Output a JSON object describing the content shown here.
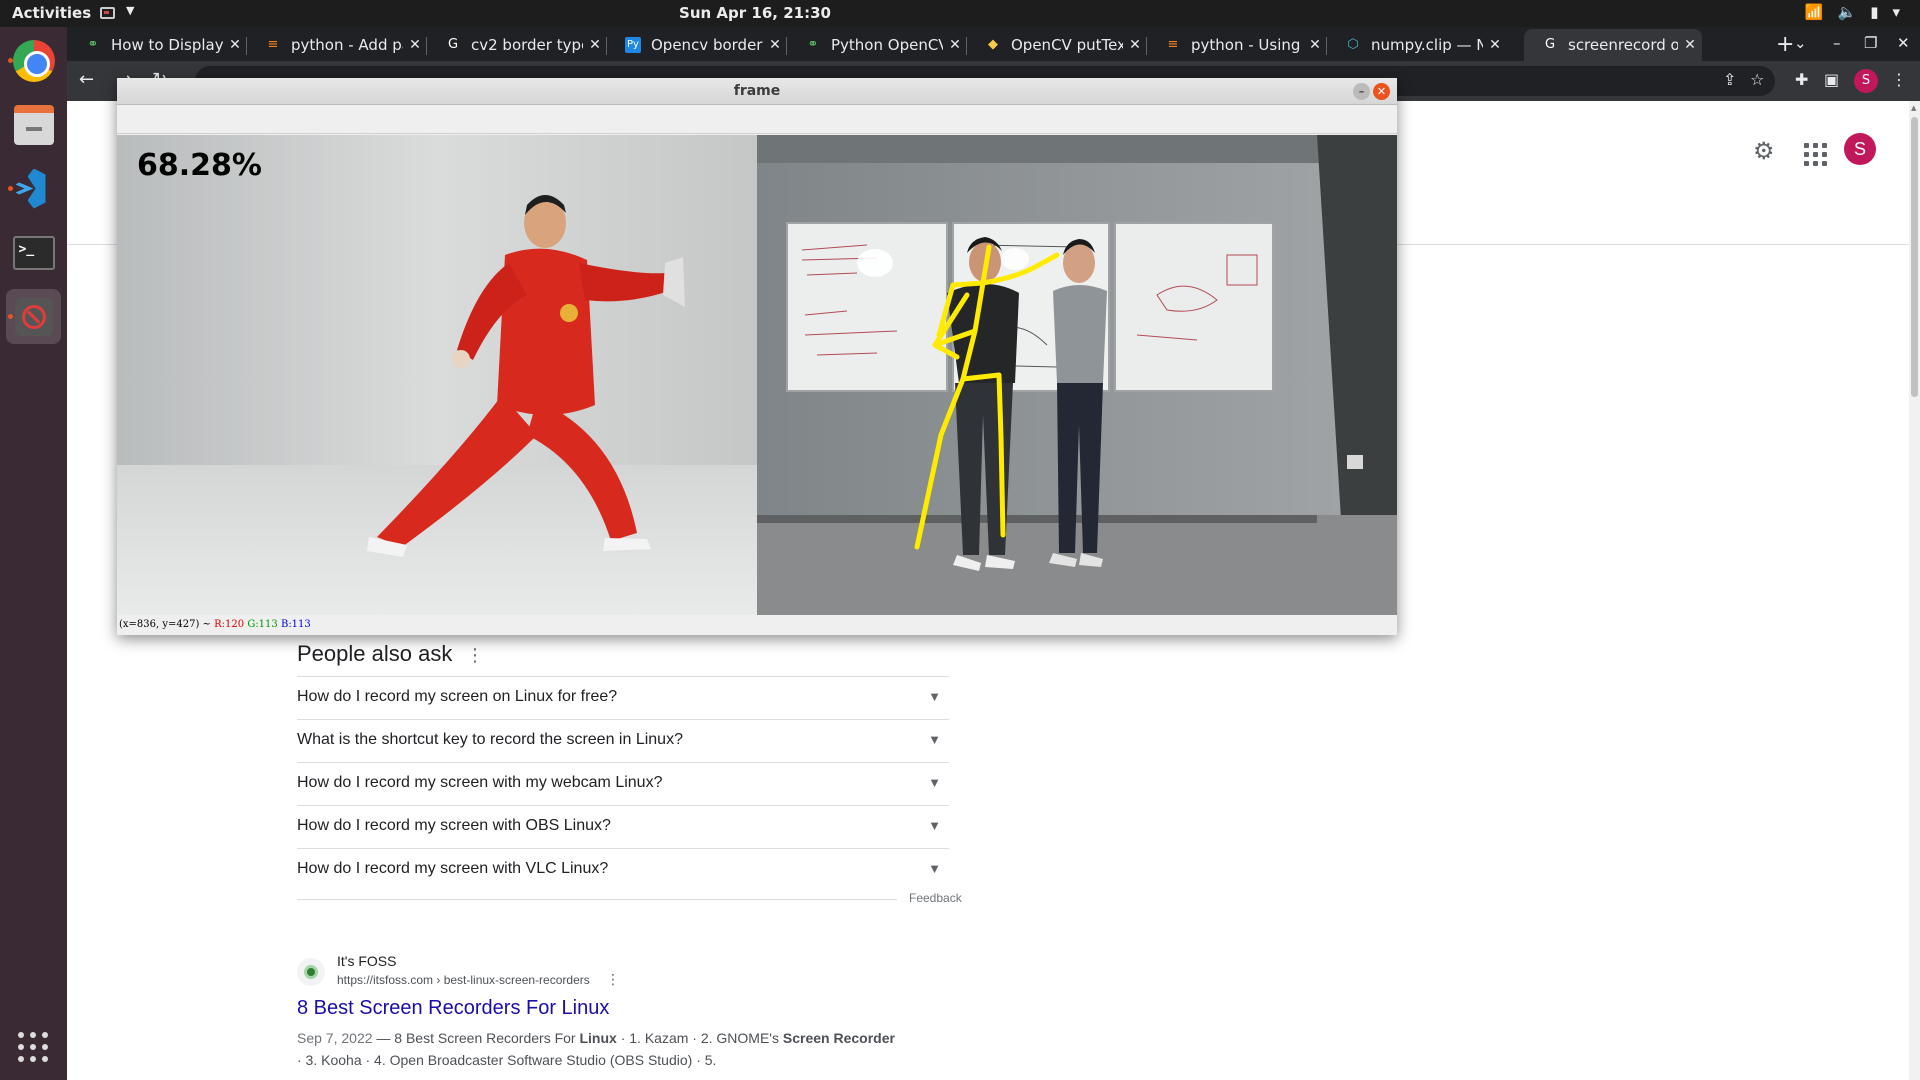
{
  "topbar": {
    "activities": "Activities",
    "clock": "Sun Apr 16, 21:30"
  },
  "browser": {
    "tabs": [
      {
        "label": "How to Display M",
        "icon": "opencv-icon"
      },
      {
        "label": "python - Add pad",
        "icon": "stackoverflow-icon"
      },
      {
        "label": "cv2 border types",
        "icon": "google-icon"
      },
      {
        "label": "Opencv border t",
        "icon": "py-site-icon"
      },
      {
        "label": "Python OpenCV",
        "icon": "opencv-icon"
      },
      {
        "label": "OpenCV putText",
        "icon": "python-icon"
      },
      {
        "label": "python - Using o",
        "icon": "stackoverflow-icon"
      },
      {
        "label": "numpy.clip — Nu",
        "icon": "numpy-icon"
      },
      {
        "label": "screenrecord on",
        "icon": "google-icon"
      }
    ],
    "omnibox": "",
    "profile_initial": "S"
  },
  "google": {
    "avatar_initial": "S",
    "paa_title": "People also ask",
    "questions": [
      "How do I record my screen on Linux for free?",
      "What is the shortcut key to record the screen in Linux?",
      "How do I record my screen with my webcam Linux?",
      "How do I record my screen with OBS Linux?",
      "How do I record my screen with VLC Linux?"
    ],
    "feedback": "Feedback",
    "result": {
      "site": "It's FOSS",
      "url": "https://itsfoss.com › best-linux-screen-recorders",
      "title": "8 Best Screen Recorders For Linux",
      "snippet_date": "Sep 7, 2022",
      "snippet_1": " — 8 Best Screen Recorders For ",
      "snippet_b1": "Linux",
      "snippet_2": " · 1. Kazam · 2. GNOME's ",
      "snippet_b2": "Screen Recorder",
      "snippet_3": " · 3. Kooha · 4. Open Broadcaster Software Studio (OBS Studio) · 5."
    }
  },
  "frame_window": {
    "title": "frame",
    "overlay_text": "68.28%",
    "status_coords": "(x=836, y=427) ~",
    "status_r": "R:120",
    "status_g": "G:113",
    "status_b": "B:113"
  },
  "colors": {
    "skeleton": "#ffeb00",
    "kungfu_suit": "#d8291f",
    "dock": "#3a2a33",
    "link": "#1a0dab"
  }
}
